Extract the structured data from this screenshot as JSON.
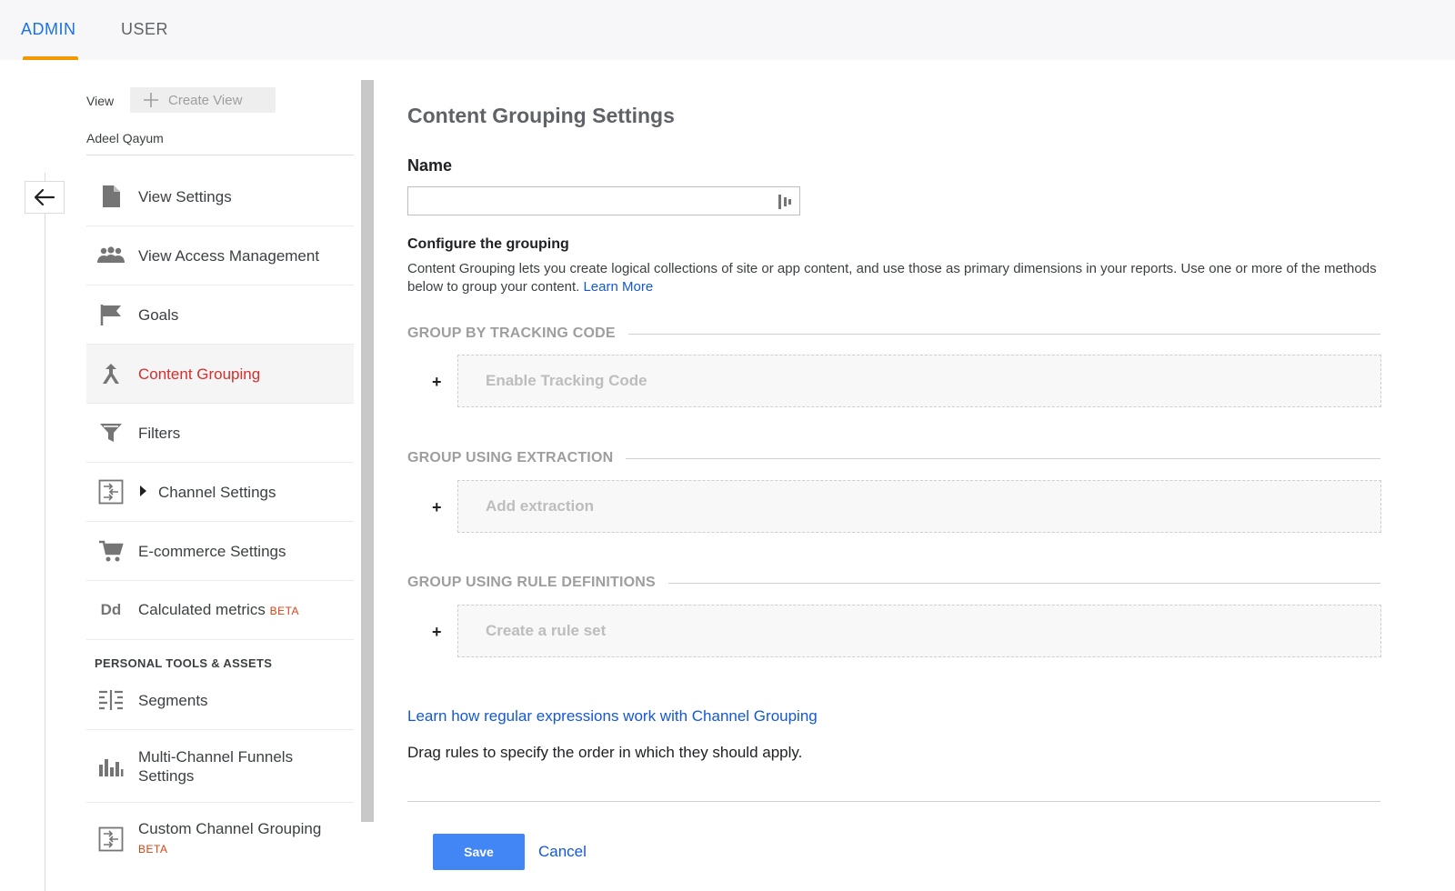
{
  "tabs": {
    "admin": "ADMIN",
    "user": "USER"
  },
  "sidebar": {
    "view_label": "View",
    "create_view": "Create View",
    "account_name": "Adeel Qayum",
    "items": [
      {
        "label": "View Settings",
        "icon": "document-icon"
      },
      {
        "label": "View Access Management",
        "icon": "people-icon"
      },
      {
        "label": "Goals",
        "icon": "flag-icon"
      },
      {
        "label": "Content Grouping",
        "icon": "content-grouping-icon"
      },
      {
        "label": "Filters",
        "icon": "filter-icon"
      },
      {
        "label": "Channel Settings",
        "icon": "channel-settings-icon"
      },
      {
        "label": "E-commerce Settings",
        "icon": "cart-icon"
      },
      {
        "label": "Calculated metrics",
        "badge": "BETA",
        "icon": "calculated-metrics-icon",
        "icon_text": "Dd"
      }
    ],
    "personal_section": "PERSONAL TOOLS & ASSETS",
    "personal_items": [
      {
        "label": "Segments",
        "icon": "segments-icon"
      },
      {
        "label": "Multi-Channel Funnels Settings",
        "line1": "Multi-Channel Funnels",
        "line2": "Settings",
        "icon": "bar-chart-icon"
      },
      {
        "label": "Custom Channel Grouping",
        "badge": "BETA",
        "icon": "custom-channel-icon"
      }
    ]
  },
  "main": {
    "title": "Content Grouping Settings",
    "name_label": "Name",
    "name_value": "",
    "configure_title": "Configure the grouping",
    "configure_desc": "Content Grouping lets you create logical collections of site or app content, and use those as primary dimensions in your reports. Use one or more of the methods below to group your content.",
    "learn_more": "Learn More",
    "groups": [
      {
        "heading": "GROUP BY TRACKING CODE",
        "plus": "+",
        "action": "Enable Tracking Code"
      },
      {
        "heading": "GROUP USING EXTRACTION",
        "plus": "+",
        "action": "Add extraction"
      },
      {
        "heading": "GROUP USING RULE DEFINITIONS",
        "plus": "+",
        "action": "Create a rule set"
      }
    ],
    "regex_link": "Learn how regular expressions work with Channel Grouping",
    "drag_text": "Drag rules to specify the order in which they should apply.",
    "save_label": "Save",
    "cancel_label": "Cancel"
  },
  "colors": {
    "accent_blue": "#1a73e8",
    "tab_underline": "#f29900",
    "active_red": "#d32f2f",
    "save_button": "#4285f4"
  }
}
